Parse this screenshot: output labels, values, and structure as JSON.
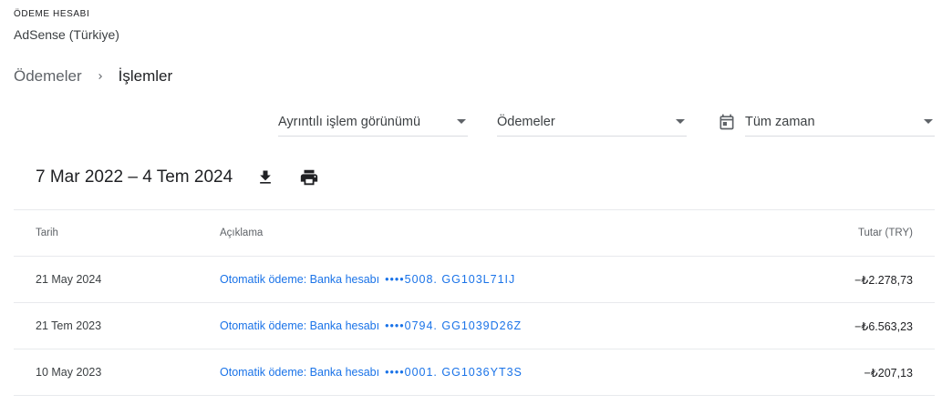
{
  "account": {
    "label": "ÖDEME HESABI",
    "name": "AdSense (Türkiye)"
  },
  "breadcrumb": {
    "parent": "Ödemeler",
    "current": "İşlemler"
  },
  "filters": {
    "view": "Ayrıntılı işlem görünümü",
    "type": "Ödemeler",
    "date": "Tüm zaman"
  },
  "range": {
    "title": "7 Mar 2022 – 4 Tem 2024"
  },
  "icons": {
    "dropdown": "chevron-down-icon",
    "calendar": "calendar-icon",
    "download": "download-icon",
    "print": "print-icon",
    "breadcrumb_separator": "chevron-right-icon"
  },
  "colors": {
    "link": "#1a73e8",
    "text": "#202124",
    "muted": "#5f6368",
    "divider": "#e8eaed"
  },
  "table": {
    "headers": {
      "date": "Tarih",
      "description": "Açıklama",
      "amount": "Tutar (TRY)"
    },
    "rows": [
      {
        "date": "21 May 2024",
        "description": "Otomatik ödeme: Banka hesabı",
        "masked": "••••5008. GG103L71IJ",
        "amount": "−₺2.278,73"
      },
      {
        "date": "21 Tem 2023",
        "description": "Otomatik ödeme: Banka hesabı",
        "masked": "••••0794. GG1039D26Z",
        "amount": "−₺6.563,23"
      },
      {
        "date": "10 May 2023",
        "description": "Otomatik ödeme: Banka hesabı",
        "masked": "••••0001. GG1036YT3S",
        "amount": "−₺207,13"
      }
    ]
  }
}
